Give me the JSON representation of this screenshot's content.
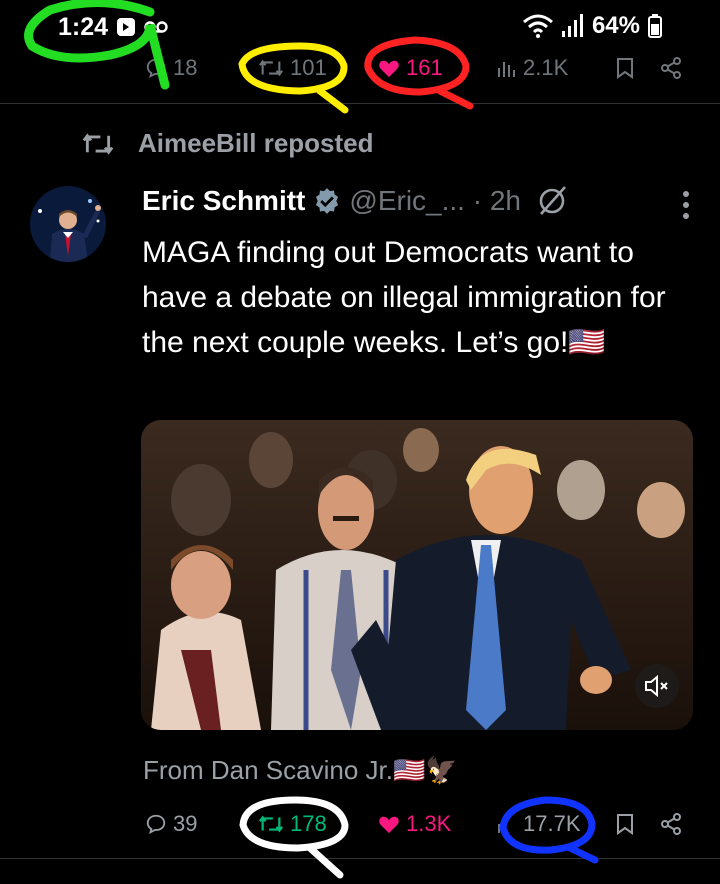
{
  "status_bar": {
    "time": "1:24",
    "battery": "64%",
    "icons": [
      "alarm-icon",
      "voicemail-icon",
      "wifi-icon",
      "signal-icon",
      "battery-icon"
    ]
  },
  "top_actions": {
    "replies": "18",
    "reposts": "101",
    "likes": "161",
    "views": "2.1K"
  },
  "repost": {
    "label": "AimeeBill reposted"
  },
  "tweet": {
    "author_name": "Eric Schmitt",
    "handle_time": "@Eric_... · 2h",
    "text": "MAGA finding out Democrats want to have a debate on illegal immigration for the next couple weeks. Let’s go!🇺🇸",
    "from_label": "From Dan Scavino Jr.🇺🇸🦅",
    "actions": {
      "replies": "39",
      "reposts": "178",
      "likes": "1.3K",
      "views": "17.7K"
    }
  },
  "colors": {
    "background": "#000000",
    "repost_green": "#00ba7c",
    "like_pink": "#f91880",
    "muted_gray": "#71767b",
    "circle_green": "#22dd22",
    "circle_yellow": "#ffee00",
    "circle_red": "#ff2222",
    "circle_white": "#ffffff",
    "circle_blue": "#1133ff"
  }
}
